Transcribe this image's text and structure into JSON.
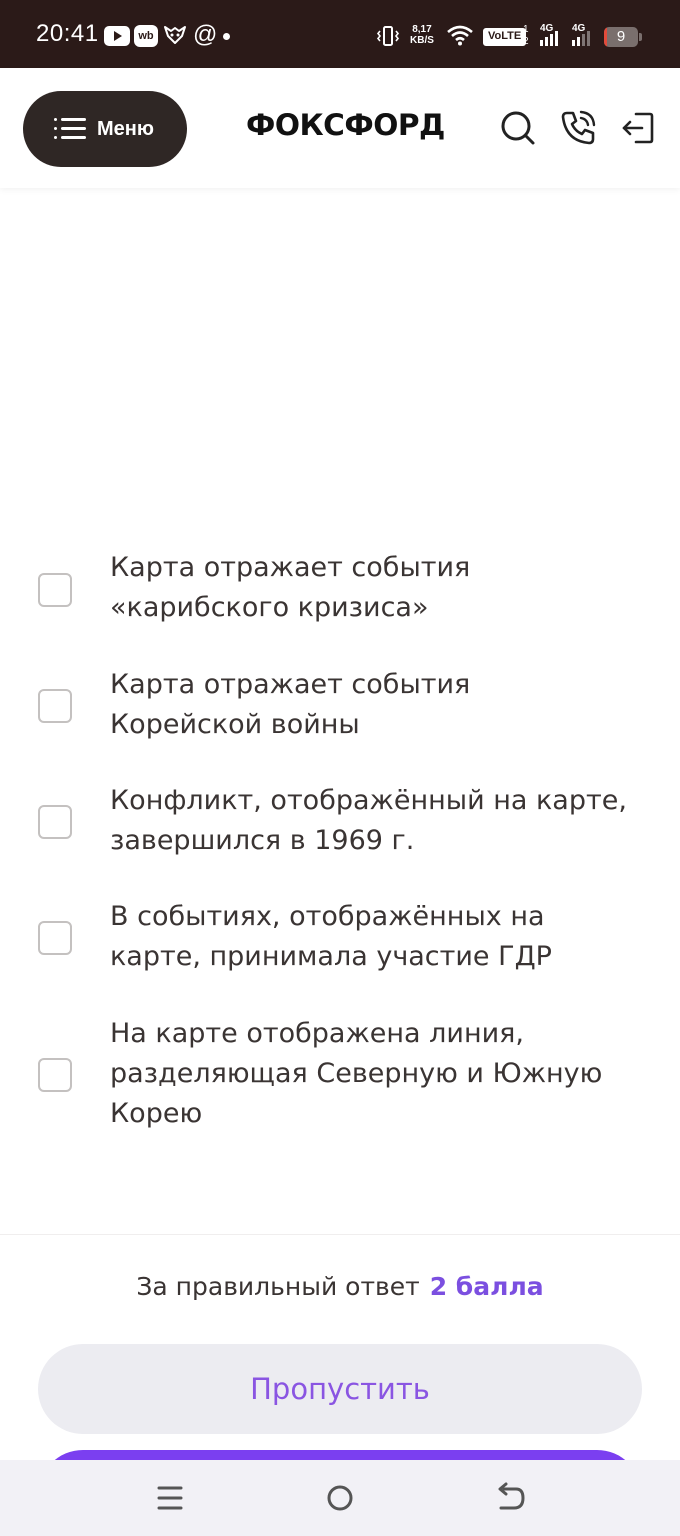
{
  "status_bar": {
    "time": "20:41",
    "net_speed_value": "8,17",
    "net_speed_unit": "KB/S",
    "volte": "VoLTE",
    "sim_slots": "1\n2",
    "network_1": "4G",
    "network_2": "4G",
    "battery_level": "9",
    "battery_percent": 9,
    "app_icon_wb": "wb",
    "icons": [
      "youtube-icon",
      "wb-icon",
      "fox-icon",
      "at-icon",
      "vibrate-icon",
      "wifi-icon",
      "signal-icon",
      "battery-icon"
    ]
  },
  "header": {
    "menu_label": "Меню",
    "logo_text": "ФОКСФОРД",
    "icons": [
      "search-icon",
      "phone-icon",
      "login-icon"
    ]
  },
  "options": [
    {
      "text": "Карта отражает события «карибского кризиса»",
      "checked": false
    },
    {
      "text": "Карта отражает события Корейской войны",
      "checked": false
    },
    {
      "text": "Конфликт, отображённый на карте, завершился в 1969 г.",
      "checked": false
    },
    {
      "text": "В событиях, отображённых на карте, принимала участие ГДР",
      "checked": false
    },
    {
      "text": "На карте отображена линия, разделяющая Северную и Южную Корею",
      "checked": false
    }
  ],
  "footer": {
    "points_label": "За правильный ответ",
    "points_value": "2 балла",
    "skip_label": "Пропустить"
  },
  "colors": {
    "accent": "#7b4fe0",
    "status_bar": "#2b1a18",
    "menu_button": "#2f2725",
    "skip_bg": "#ececf1",
    "nav_bg": "#f2f1f6"
  },
  "navbar": {
    "icons": [
      "recents-icon",
      "home-icon",
      "back-icon"
    ]
  }
}
